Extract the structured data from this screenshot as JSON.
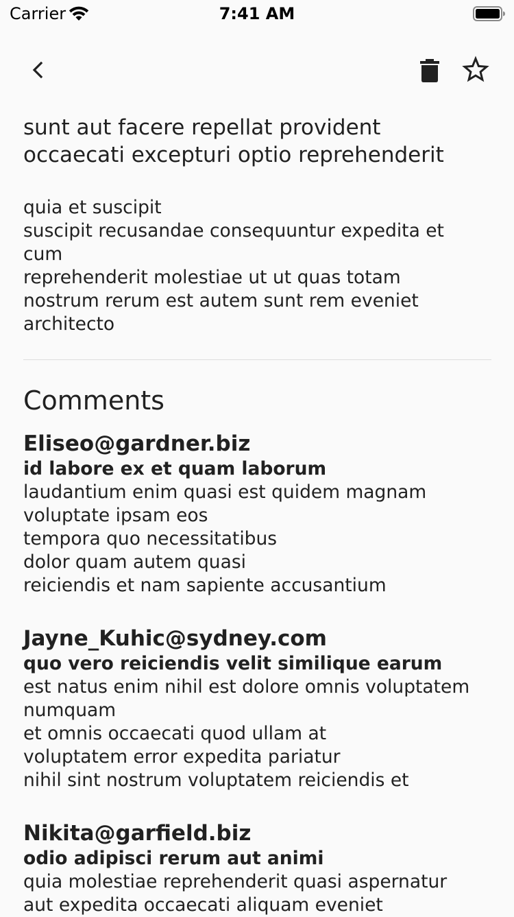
{
  "status_bar": {
    "carrier": "Carrier",
    "time": "7:41 AM"
  },
  "nav": {
    "back_icon": "chevron-left-icon",
    "trash_icon": "trash-icon",
    "star_icon": "star-outline-icon"
  },
  "post": {
    "title": "sunt aut facere repellat provident\noccaecati excepturi optio reprehenderit",
    "body": "quia et suscipit\nsuscipit recusandae consequuntur expedita et\ncum\nreprehenderit molestiae ut ut quas totam\nnostrum rerum est autem sunt rem eveniet\narchitecto"
  },
  "comments": {
    "heading": "Comments",
    "items": [
      {
        "email": "Eliseo@gardner.biz",
        "name": "id labore ex et quam laborum",
        "body": "laudantium enim quasi est quidem magnam\nvoluptate ipsam eos\ntempora quo necessitatibus\ndolor quam autem quasi\nreiciendis et nam sapiente accusantium"
      },
      {
        "email": "Jayne_Kuhic@sydney.com",
        "name": "quo vero reiciendis velit similique earum",
        "body": "est natus enim nihil est dolore omnis voluptatem\nnumquam\net omnis occaecati quod ullam at\nvoluptatem error expedita pariatur\nnihil sint nostrum voluptatem reiciendis et"
      },
      {
        "email": "Nikita@garfield.biz",
        "name": "odio adipisci rerum aut animi",
        "body": "quia molestiae reprehenderit quasi aspernatur\naut expedita occaecati aliquam eveniet"
      }
    ]
  }
}
